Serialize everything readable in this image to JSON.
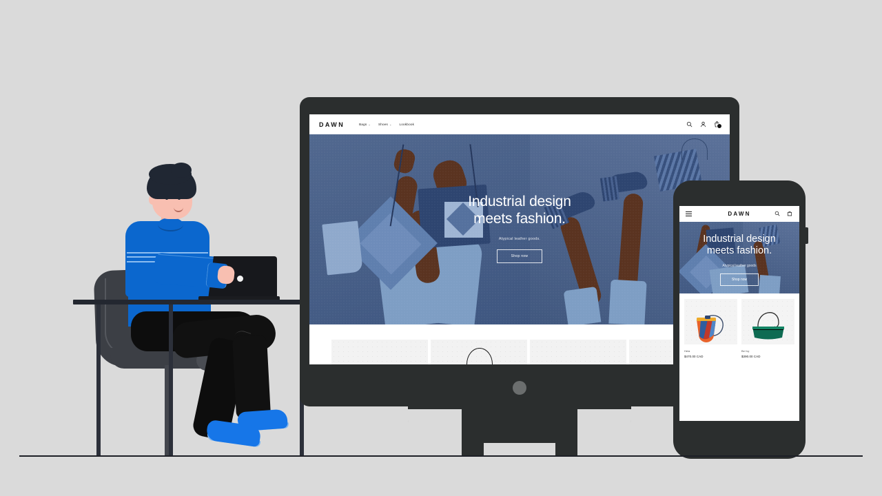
{
  "scene": {
    "background_color": "#dadada",
    "device_color": "#2b2e2e",
    "accent_blue": "#0b67ce"
  },
  "desktop": {
    "header": {
      "brand": "DAWN",
      "nav": [
        {
          "label": "Bags",
          "caret": "⌄"
        },
        {
          "label": "Shoes",
          "caret": "⌄"
        },
        {
          "label": "Lookbook",
          "caret": ""
        }
      ],
      "icons": [
        "search-icon",
        "account-icon",
        "cart-icon"
      ],
      "cart_badge": ""
    },
    "hero": {
      "heading_line1": "Industrial design",
      "heading_line2": "meets fashion.",
      "subtitle": "Atypical leather goods.",
      "cta": "Shop now"
    },
    "product_strip": {
      "cells": [
        "",
        "",
        "",
        ""
      ]
    }
  },
  "mobile": {
    "header": {
      "brand": "DAWN",
      "icons": [
        "menu-icon",
        "search-icon",
        "cart-icon"
      ]
    },
    "hero": {
      "heading_line1": "Industrial design",
      "heading_line2": "meets fashion.",
      "subtitle": "Atypical leather goods",
      "cta": "Shop now"
    },
    "products": [
      {
        "name": "Hela",
        "price": "$470.00 CAD",
        "swatch": "striped-bucket-bag"
      },
      {
        "name": "Be Ivy",
        "price": "$390.00 CAD",
        "swatch": "green-shoulder-bag"
      }
    ]
  },
  "illustration": {
    "subject": "person-at-laptop",
    "sweater_color": "#0b67ce",
    "shoe_color": "#1676e8",
    "hair_color": "#202733",
    "skin_color": "#f8bfb1"
  }
}
